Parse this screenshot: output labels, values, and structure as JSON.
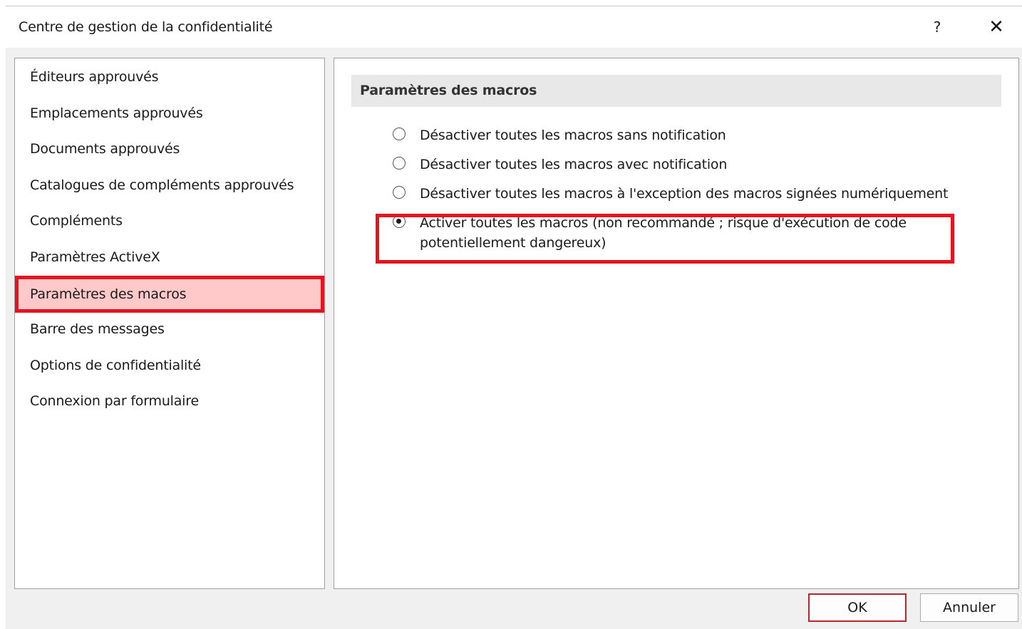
{
  "window": {
    "title": "Centre de gestion de la confidentialité",
    "help_label": "?",
    "close_label": "✕"
  },
  "sidebar": {
    "items": [
      {
        "label": "Éditeurs approuvés"
      },
      {
        "label": "Emplacements approuvés"
      },
      {
        "label": "Documents approuvés"
      },
      {
        "label": "Catalogues de compléments approuvés"
      },
      {
        "label": "Compléments"
      },
      {
        "label": "Paramètres ActiveX"
      },
      {
        "label": "Paramètres des macros",
        "selected": true
      },
      {
        "label": "Barre des messages"
      },
      {
        "label": "Options de confidentialité"
      },
      {
        "label": "Connexion par formulaire"
      }
    ]
  },
  "main": {
    "section_title": "Paramètres des macros",
    "options": [
      {
        "label": "Désactiver toutes les macros sans notification",
        "checked": false
      },
      {
        "label": "Désactiver toutes les macros avec notification",
        "checked": false
      },
      {
        "label": "Désactiver toutes les macros à l'exception des macros signées numériquement",
        "checked": false
      },
      {
        "label_line1": "Activer toutes les macros (non recommandé ; risque d'exécution de code",
        "label_line2": "potentiellement dangereux)",
        "checked": true
      }
    ]
  },
  "footer": {
    "ok_label": "OK",
    "cancel_label": "Annuler"
  },
  "colors": {
    "highlight_red": "#e3141f",
    "selected_bg": "#ffc9ca"
  }
}
